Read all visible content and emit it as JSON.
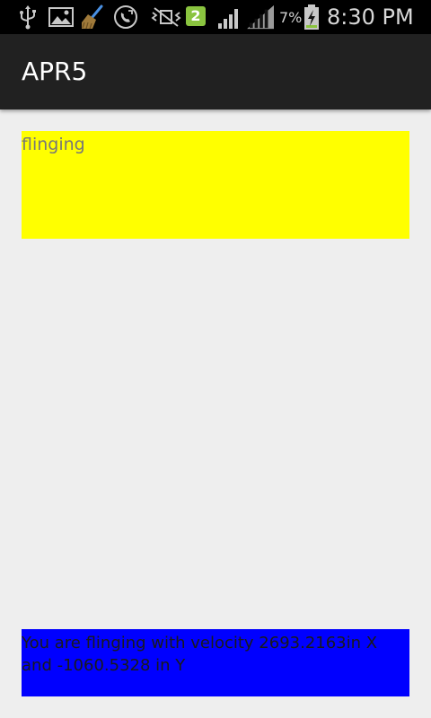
{
  "status_bar": {
    "icons": [
      "usb-icon",
      "image-icon",
      "broom-icon",
      "phone-sync-icon",
      "vibrate-mute-icon",
      "notification-count-icon",
      "signal-icon",
      "signal-icon",
      "battery-charging-icon"
    ],
    "notification_count": "2",
    "battery_percent": "7%",
    "clock": "8:30 PM"
  },
  "app": {
    "title": "APR5"
  },
  "gesture": {
    "status": "flinging",
    "velocity_message": "You are flinging with velocity 2693.2163in X and -1060.5328 in Y"
  },
  "colors": {
    "status_bar_bg": "#000000",
    "action_bar_bg": "#212121",
    "page_bg": "#eeeeee",
    "status_panel_bg": "#ffff00",
    "velocity_panel_bg": "#0000ff",
    "battery_fill": "#8ac43f"
  }
}
